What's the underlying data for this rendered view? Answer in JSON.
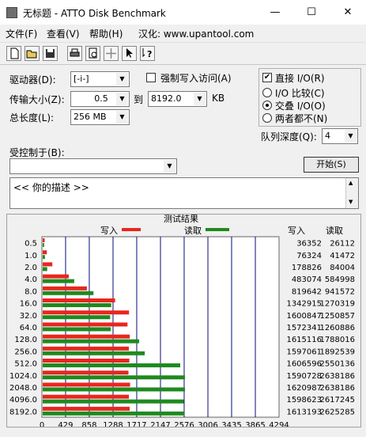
{
  "window": {
    "title": "无标题 - ATTO Disk Benchmark",
    "minimize": "—",
    "maximize": "☐",
    "close": "✕"
  },
  "menu": [
    "文件(F)",
    "查看(V)",
    "帮助(H)",
    "汉化: www.upantool.com"
  ],
  "toolbar": [
    "new",
    "open",
    "save",
    "print",
    "print-preview",
    "move",
    "context-help"
  ],
  "controls": {
    "drive_label": "驱动器(D):",
    "drive_value": "[-i-]",
    "force_write_label": "强制写入访问(A)",
    "direct_io_label": "直接 I/O(R)",
    "transfer_label": "传输大小(Z):",
    "transfer_from": "0.5",
    "to_label": "到",
    "transfer_to": "8192.0",
    "kb_label": "KB",
    "total_label": "总长度(L):",
    "total_value": "256 MB",
    "io_compare_label": "I/O 比较(C)",
    "overlapped_label": "交叠 I/O(O)",
    "neither_label": "两者都不(N)",
    "queue_label": "队列深度(Q):",
    "queue_value": "4",
    "controlled_label": "受控制于(B):",
    "start_label": "开始(S)",
    "desc_text": "<<  你的描述  >>"
  },
  "colors": {
    "write": "#e8261f",
    "read": "#1f8a1f",
    "grid": "#0a0a7a"
  },
  "chart_data": {
    "type": "bar",
    "title": "测试结果",
    "legend": [
      "写入",
      "读取"
    ],
    "col_headers": [
      "写入",
      "读取"
    ],
    "xlabel": "传输速率 - MB / 秒",
    "xlim": [
      0,
      4294
    ],
    "x_ticks": [
      "0",
      "429",
      "858",
      "1288",
      "1717",
      "2147",
      "2576",
      "3006",
      "3435",
      "3865",
      "4294"
    ],
    "categories": [
      "0.5",
      "1.0",
      "2.0",
      "4.0",
      "8.0",
      "16.0",
      "32.0",
      "64.0",
      "128.0",
      "256.0",
      "512.0",
      "1024.0",
      "2048.0",
      "4096.0",
      "8192.0"
    ],
    "series": [
      {
        "name": "写入",
        "values": [
          36352,
          76324,
          178826,
          483074,
          819642,
          1342915,
          1600847,
          1572341,
          1615116,
          1597061,
          1606596,
          1590728,
          1620987,
          1598623,
          1613193
        ]
      },
      {
        "name": "读取",
        "values": [
          26112,
          41472,
          84004,
          584998,
          941572,
          1270319,
          1250857,
          1260886,
          1788016,
          1892539,
          2550136,
          2638186,
          2638186,
          2617245,
          2625285
        ]
      }
    ]
  }
}
